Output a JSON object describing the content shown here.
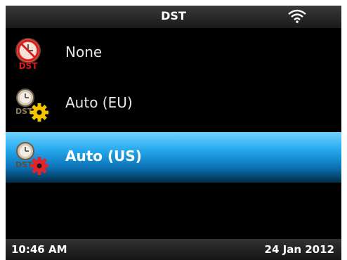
{
  "header": {
    "title": "DST"
  },
  "menu": {
    "items": [
      {
        "label": "None",
        "icon": "dst-off-icon"
      },
      {
        "label": "Auto (EU)",
        "icon": "clock-gear-icon"
      },
      {
        "label": "Auto (US)",
        "icon": "clock-gear-red-icon"
      }
    ]
  },
  "footer": {
    "time": "10:46 AM",
    "date": "24 Jan 2012"
  },
  "colors": {
    "selection": "#1ea2e8",
    "background": "#000000",
    "gear_yellow": "#f5c400",
    "gear_red": "#e3222a"
  }
}
